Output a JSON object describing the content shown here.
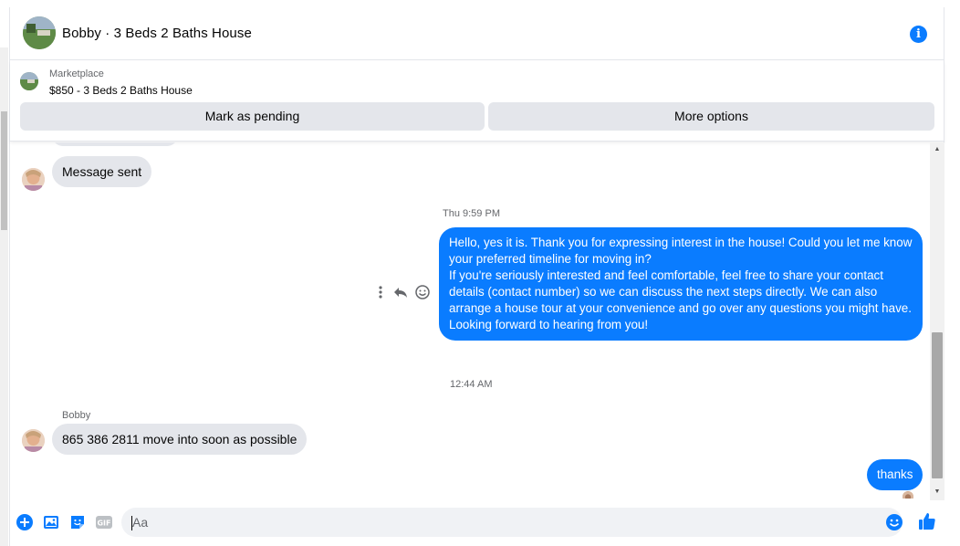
{
  "conversation": {
    "title": "Bobby · 3 Beds 2 Baths House"
  },
  "marketplace": {
    "label": "Marketplace",
    "listing": "$850 - 3 Beds 2 Baths House",
    "actions": {
      "pending": "Mark as pending",
      "more": "More options"
    }
  },
  "messages": {
    "sent_notice": "Message sent",
    "timestamp_1": "Thu 9:59 PM",
    "outgoing_1": [
      "Hello, yes it is. Thank you for expressing interest in the house! Could you let me know your preferred timeline for moving in?",
      "If you're seriously interested and feel comfortable, feel free to share your contact details (contact number) so we can discuss the next steps directly. We can also arrange a house tour at your convenience and go over any questions you might have.",
      "Looking forward to hearing from you!"
    ],
    "timestamp_2": "12:44 AM",
    "sender": "Bobby",
    "incoming_2": "865 386 2811 move into soon as possible",
    "outgoing_2": "thanks"
  },
  "composer": {
    "placeholder": "Aa"
  },
  "icons": {
    "info": "info-icon",
    "more": "more-vertical-icon",
    "reply": "reply-icon",
    "react": "smiley-icon",
    "add": "plus-circle-icon",
    "photo": "photo-icon",
    "sticker": "sticker-icon",
    "gif": "gif-icon",
    "emoji": "emoji-icon",
    "like": "thumbs-up-icon"
  },
  "colors": {
    "accent": "#0a7cff",
    "incoming_bubble": "#e4e6eb",
    "secondary_text": "#65676b"
  }
}
